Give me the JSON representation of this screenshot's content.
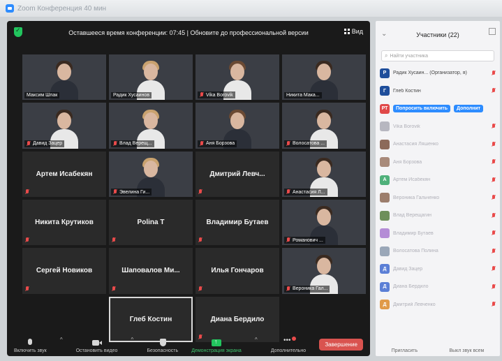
{
  "os_title": "Zoom Конференция 40 мин",
  "meeting": {
    "banner": "Оставшееся время конференции: 07:45 | Обновите до профессиональной версии",
    "view_label": "Вид"
  },
  "tiles": [
    {
      "name": "Максим Шпак",
      "kind": "video",
      "muted": false
    },
    {
      "name": "Радик Хусаинов",
      "kind": "video",
      "muted": false
    },
    {
      "name": "Vika Borovik",
      "kind": "video",
      "muted": true
    },
    {
      "name": "Никита Мака...",
      "kind": "video",
      "muted": false
    },
    {
      "name": "Давид Зацер",
      "kind": "video",
      "muted": true
    },
    {
      "name": "Влад Верещ...",
      "kind": "video",
      "muted": true
    },
    {
      "name": "Аня Борзова",
      "kind": "video",
      "muted": true
    },
    {
      "name": "Волосатова ...",
      "kind": "video",
      "muted": true
    },
    {
      "name": "Артем Исабекян",
      "kind": "name",
      "muted": true
    },
    {
      "name": "Эвелина Ги...",
      "kind": "video",
      "muted": true
    },
    {
      "name": "Дмитрий Левч...",
      "kind": "name",
      "muted": true
    },
    {
      "name": "Анастасия Л...",
      "kind": "video",
      "muted": true
    },
    {
      "name": "Никита Крутиков",
      "kind": "name",
      "muted": true
    },
    {
      "name": "Polina T",
      "kind": "name",
      "muted": true
    },
    {
      "name": "Владимир Бутаев",
      "kind": "name",
      "muted": true
    },
    {
      "name": "Романович ...",
      "kind": "video",
      "muted": true
    },
    {
      "name": "Сергей Новиков",
      "kind": "name",
      "muted": true
    },
    {
      "name": "Шаповалов Ми...",
      "kind": "name",
      "muted": true
    },
    {
      "name": "Илья Гончаров",
      "kind": "name",
      "muted": true
    },
    {
      "name": "Вероника Гал...",
      "kind": "video",
      "muted": true
    },
    {
      "name": "",
      "kind": "empty",
      "muted": false
    },
    {
      "name": "Глеб Костин",
      "kind": "name",
      "muted": false,
      "highlight": true
    },
    {
      "name": "Диана Бердило",
      "kind": "name",
      "muted": true
    },
    {
      "name": "",
      "kind": "empty",
      "muted": false
    }
  ],
  "toolbar": {
    "mic_label": "Включить звук",
    "video_label": "Остановить видео",
    "security_label": "Безопасность",
    "share_label": "Демонстрация экрана",
    "more_label": "Дополнительно",
    "end_label": "Завершение"
  },
  "panel": {
    "title": "Участники (22)",
    "search_placeholder": "Найти участника",
    "participants": [
      {
        "initials": "P",
        "name": "Радик Хусаин... (Организатор, я)",
        "color": "#1f4e9b",
        "faded": false
      },
      {
        "initials": "Г",
        "name": "Глеб Костин",
        "color": "#1f4e9b",
        "faded": false
      },
      {
        "initials": "РТ",
        "name": "",
        "color": "#e04848",
        "faded": false,
        "ask_label": "Попросить включить",
        "more_label": "Дополнит"
      },
      {
        "initials": "",
        "name": "Vika Borovik",
        "color": "#b7b7c0",
        "faded": true
      },
      {
        "initials": "",
        "name": "Анастасия Ляшенко",
        "color": "#8c6a5a",
        "faded": true
      },
      {
        "initials": "",
        "name": "Аня Борзова",
        "color": "#a88a7a",
        "faded": true
      },
      {
        "initials": "А",
        "name": "Артем Исабекян",
        "color": "#4fb07a",
        "faded": true
      },
      {
        "initials": "",
        "name": "Вероника Гальченко",
        "color": "#9c7d6c",
        "faded": true
      },
      {
        "initials": "",
        "name": "Влад Верещагин",
        "color": "#6e8f5a",
        "faded": true
      },
      {
        "initials": "",
        "name": "Владимир Бутаев",
        "color": "#b48cd6",
        "faded": true
      },
      {
        "initials": "",
        "name": "Волосатова Полина",
        "color": "#9aa7b8",
        "faded": true
      },
      {
        "initials": "Д",
        "name": "Давид Зацер",
        "color": "#5b7fd6",
        "faded": true
      },
      {
        "initials": "Д",
        "name": "Диана Бердило",
        "color": "#5b7fd6",
        "faded": true
      },
      {
        "initials": "Д",
        "name": "Дмитрий Левченко",
        "color": "#e09a48",
        "faded": true
      }
    ],
    "footer_left": "Пригласить",
    "footer_right": "Выкл звук всем"
  }
}
